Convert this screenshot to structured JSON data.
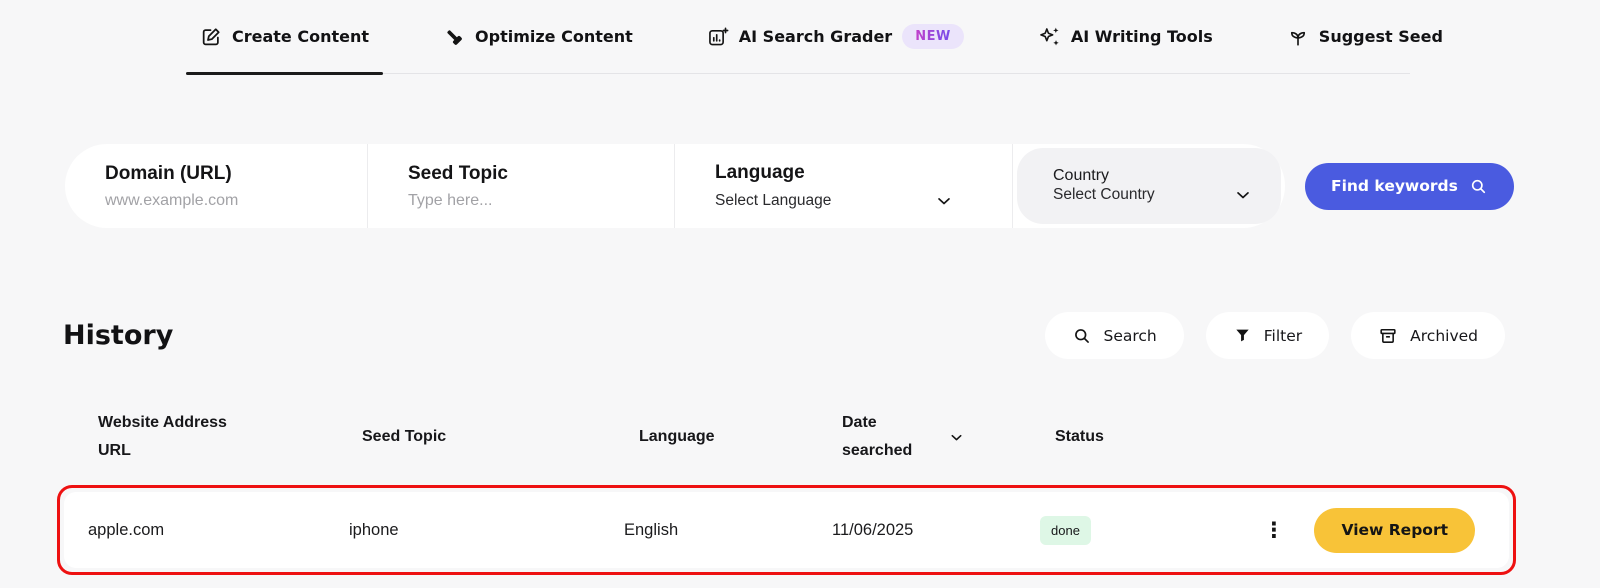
{
  "tabs": [
    {
      "label": "Create Content",
      "icon": "edit-icon",
      "active": true
    },
    {
      "label": "Optimize Content",
      "icon": "hammer-icon",
      "active": false
    },
    {
      "label": "AI Search Grader",
      "icon": "chart-icon",
      "badge": "NEW",
      "active": false
    },
    {
      "label": "AI Writing Tools",
      "icon": "sparkles-icon",
      "active": false
    },
    {
      "label": "Suggest Seed",
      "icon": "seedling-icon",
      "active": false
    }
  ],
  "search_form": {
    "domain": {
      "label": "Domain (URL)",
      "placeholder": "www.example.com"
    },
    "seed_topic": {
      "label": "Seed Topic",
      "placeholder": "Type here..."
    },
    "language": {
      "label": "Language",
      "value": "Select Language"
    },
    "country": {
      "label": "Country",
      "value": "Select Country"
    },
    "submit_label": "Find keywords"
  },
  "history": {
    "title": "History",
    "actions": {
      "search": "Search",
      "filter": "Filter",
      "archived": "Archived"
    },
    "table": {
      "columns": [
        "Website Address URL",
        "Seed Topic",
        "Language",
        "Date searched",
        "Status"
      ],
      "rows": [
        {
          "url": "apple.com",
          "seed_topic": "iphone",
          "language": "English",
          "date_searched": "11/06/2025",
          "status": "done",
          "action_label": "View Report"
        }
      ]
    }
  },
  "colors": {
    "accent_blue": "#4a5be0",
    "accent_yellow": "#f8c338",
    "status_done_bg": "#def7e6",
    "new_badge_bg": "#ebe4fb",
    "highlight_red": "#ee1111",
    "page_bg": "#f7f7f8"
  }
}
